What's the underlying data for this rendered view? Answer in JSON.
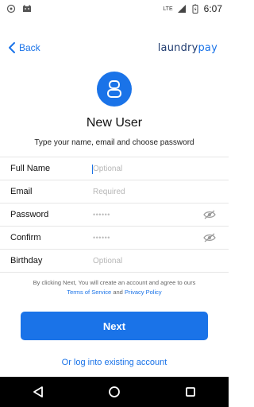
{
  "status_bar": {
    "time": "6:07",
    "network": "LTE",
    "icons": [
      "android-debug-icon",
      "cat-icon",
      "signal-icon",
      "battery-icon"
    ]
  },
  "header": {
    "back_label": "Back",
    "logo_prefix": "laundry",
    "logo_suffix": "pay"
  },
  "page": {
    "title": "New User",
    "subtitle": "Type your name, email and choose password"
  },
  "form": {
    "full_name": {
      "label": "Full Name",
      "placeholder": "Optional"
    },
    "email": {
      "label": "Email",
      "placeholder": "Required"
    },
    "password": {
      "label": "Password",
      "value": "••••••"
    },
    "confirm": {
      "label": "Confirm",
      "value": "••••••"
    },
    "birthday": {
      "label": "Birthday",
      "placeholder": "Optional"
    }
  },
  "terms": {
    "text": "By clicking Next, You will create an account and agree to ours",
    "tos": "Terms of Service",
    "and": "and",
    "privacy": "Privacy Policy"
  },
  "actions": {
    "next": "Next",
    "login": "Or log into existing account"
  },
  "colors": {
    "accent": "#1a73e8"
  }
}
